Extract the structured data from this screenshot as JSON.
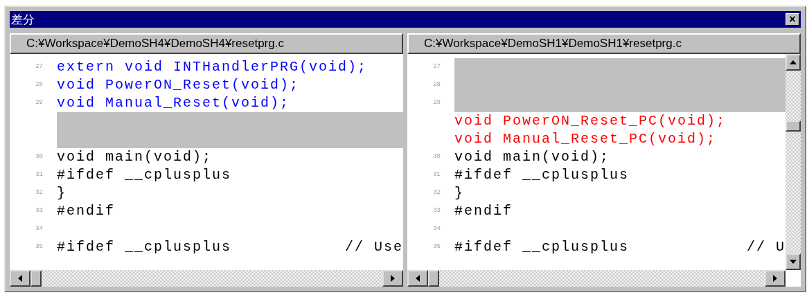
{
  "window": {
    "title": "差分",
    "close_label": "×"
  },
  "panes": [
    {
      "path": "C:¥Workspace¥DemoSH4¥DemoSH4¥resetprg.c",
      "vertical_scrollbar": false,
      "rows": [
        {
          "number": "27",
          "text": "extern void INTHandlerPRG(void);",
          "kind": "changed"
        },
        {
          "number": "28",
          "text": "void PowerON_Reset(void);",
          "kind": "changed"
        },
        {
          "number": "29",
          "text": "void Manual_Reset(void);",
          "kind": "changed"
        },
        {
          "kind": "gap"
        },
        {
          "kind": "gap"
        },
        {
          "number": "30",
          "text": "void main(void);",
          "kind": "normal"
        },
        {
          "number": "31",
          "text": "#ifdef __cplusplus",
          "kind": "normal"
        },
        {
          "number": "32",
          "text": "}",
          "kind": "normal"
        },
        {
          "number": "33",
          "text": "#endif",
          "kind": "normal"
        },
        {
          "number": "34",
          "kind": "normal"
        },
        {
          "number": "35",
          "text": "#ifdef __cplusplus",
          "comment": "// Use",
          "kind": "normal"
        }
      ]
    },
    {
      "path": "C:¥Workspace¥DemoSH1¥DemoSH1¥resetprg.c",
      "vertical_scrollbar": true,
      "rows": [
        {
          "number": "27",
          "kind": "gap"
        },
        {
          "number": "28",
          "kind": "gap"
        },
        {
          "number": "29",
          "kind": "gap"
        },
        {
          "text": "void PowerON_Reset_PC(void);",
          "kind": "added"
        },
        {
          "text": "void Manual_Reset_PC(void);",
          "kind": "added"
        },
        {
          "number": "30",
          "text": "void main(void);",
          "kind": "normal"
        },
        {
          "number": "31",
          "text": "#ifdef __cplusplus",
          "kind": "normal"
        },
        {
          "number": "32",
          "text": "}",
          "kind": "normal"
        },
        {
          "number": "33",
          "text": "#endif",
          "kind": "normal"
        },
        {
          "number": "34",
          "kind": "normal"
        },
        {
          "number": "35",
          "text": "#ifdef __cplusplus",
          "comment": "// U",
          "kind": "normal"
        }
      ]
    }
  ]
}
